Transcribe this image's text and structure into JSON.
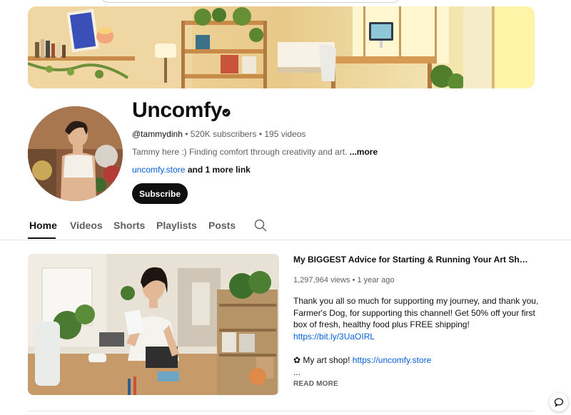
{
  "channel": {
    "name": "Uncomfy",
    "handle": "@tammydinh",
    "subscribers": "520K subscribers",
    "videos": "195 videos",
    "separator": "•",
    "description": "Tammy here :) Finding comfort through creativity and art.",
    "description_more": "...more",
    "link": "uncomfy.store",
    "more_links": "and 1 more link",
    "subscribe_label": "Subscribe"
  },
  "tabs": [
    {
      "label": "Home",
      "active": true
    },
    {
      "label": "Videos"
    },
    {
      "label": "Shorts"
    },
    {
      "label": "Playlists"
    },
    {
      "label": "Posts"
    }
  ],
  "featured_video": {
    "title": "My BIGGEST Advice for Starting & Running Your Art Shop! ✿ Small Business Tips",
    "views": "1,297,964 views",
    "age": "1 year ago",
    "separator": "•",
    "description_lines": [
      "Thank you all so much for supporting my journey, and thank you,",
      "Farmer's Dog, for supporting this channel!  Get 50% off your first",
      "box of fresh, healthy food plus FREE shipping!"
    ],
    "promo_link": "https://bit.ly/3UaOIRL",
    "shop_prefix": "✿ My art shop!",
    "shop_link": "https://uncomfy.store",
    "ellipsis": "...",
    "read_more": "READ MORE"
  },
  "icons": {
    "verified": "verified-check-icon",
    "search": "search-icon",
    "chat": "chat-bubble-icon"
  },
  "colors": {
    "link": "#065fd4",
    "subscribe_bg": "#0f0f0f",
    "muted_text": "#606060"
  }
}
